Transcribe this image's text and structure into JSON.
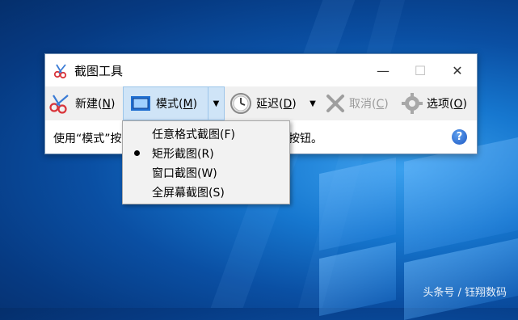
{
  "window": {
    "title": "截图工具"
  },
  "controls": {
    "minimize": "—",
    "maximize": "☐",
    "close": "✕"
  },
  "toolbar": {
    "new_label": "新建",
    "new_key": "N",
    "mode_label": "模式",
    "mode_key": "M",
    "delay_label": "延迟",
    "delay_key": "D",
    "cancel_label": "取消",
    "cancel_key": "C",
    "options_label": "选项",
    "options_key": "O"
  },
  "status": {
    "text": "使用“模式”按",
    "text_tail": "按钮。"
  },
  "menu": {
    "items": [
      {
        "label": "任意格式截图(F)",
        "selected": false
      },
      {
        "label": "矩形截图(R)",
        "selected": true
      },
      {
        "label": "窗口截图(W)",
        "selected": false
      },
      {
        "label": "全屏幕截图(S)",
        "selected": false
      }
    ]
  },
  "watermark": "头条号 / 钰翔数码",
  "colors": {
    "accent": "#1677cf",
    "mode_highlight": "#cfe4f7",
    "help": "#1c58c4"
  }
}
